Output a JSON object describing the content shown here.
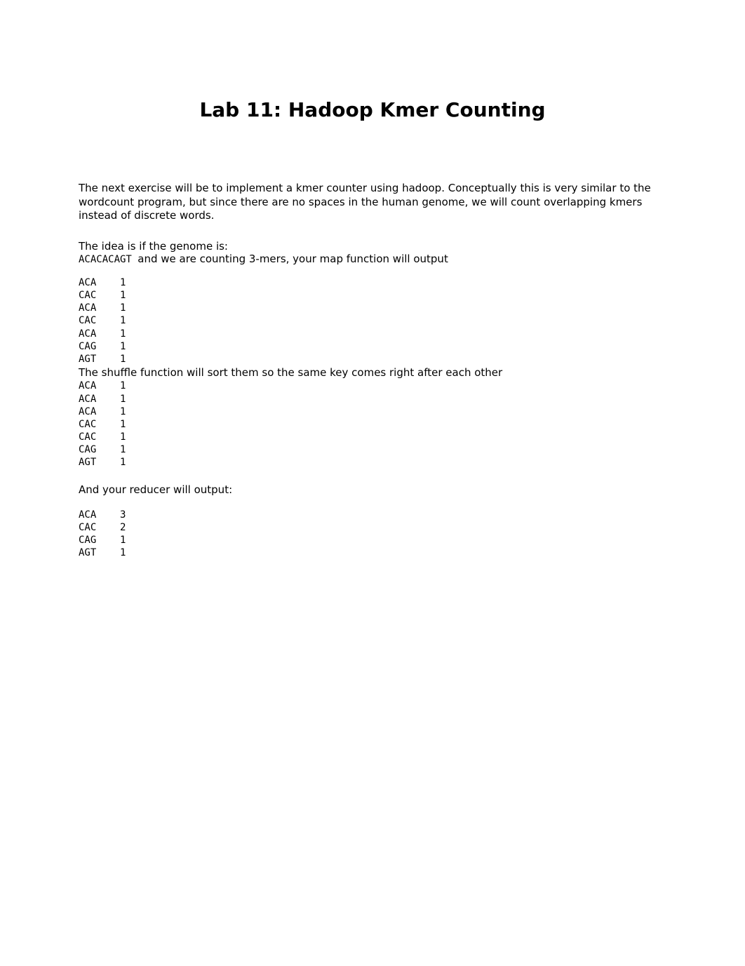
{
  "title": "Lab 11: Hadoop Kmer Counting",
  "intro": "The next exercise will be to implement a kmer counter using hadoop. Conceptually this is very similar to the wordcount program, but since there are no spaces in the human genome, we will count overlapping kmers instead of discrete words.",
  "idea_line": "The idea is if the genome is:",
  "genome": "ACACACAGT ",
  "after_genome": "and we are counting 3-mers, your map function will output",
  "map_output": "ACA    1\nCAC    1\nACA    1\nCAC    1\nACA    1\nCAG    1\nAGT    1",
  "shuffle_text": "The shuffle function will sort them so the same key comes right after each other",
  "shuffle_output": "ACA    1\nACA    1\nACA    1\nCAC    1\nCAC    1\nCAG    1\nAGT    1",
  "reducer_text": "And your reducer will output:",
  "reducer_output": "ACA    3\nCAC    2\nCAG    1\nAGT    1"
}
